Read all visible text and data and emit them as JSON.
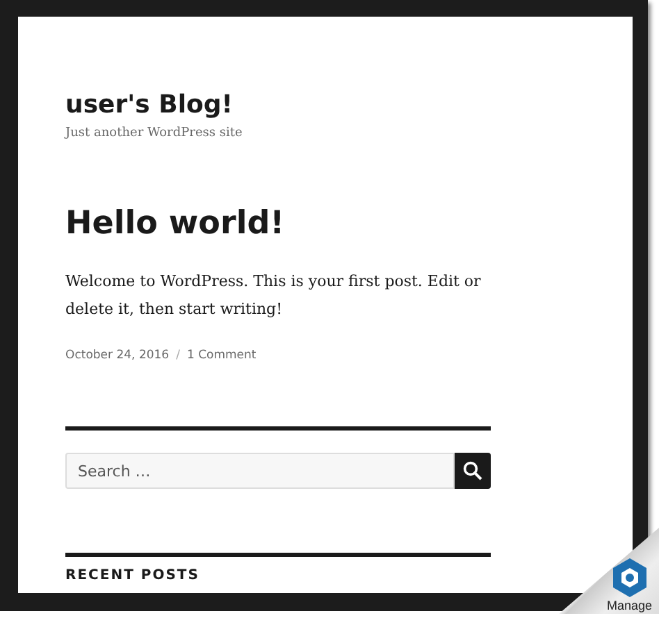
{
  "site": {
    "title": "user's Blog!",
    "tagline": "Just another WordPress site"
  },
  "post": {
    "title": "Hello world!",
    "body": "Welcome to WordPress. This is your first post. Edit or delete it, then start writing!",
    "date": "October 24, 2016",
    "separator": "/",
    "comments": "1 Comment"
  },
  "search": {
    "placeholder": "Search …"
  },
  "widget": {
    "title": "RECENT POSTS"
  },
  "corner": {
    "label": "Manage"
  }
}
